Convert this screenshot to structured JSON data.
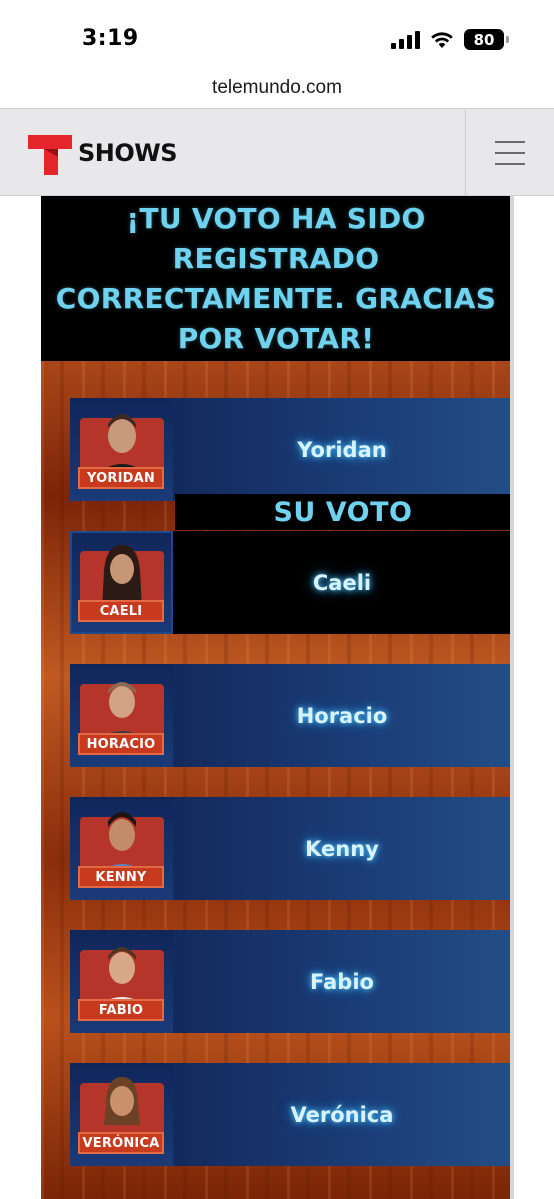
{
  "status_bar": {
    "time": "3:19",
    "battery": "80"
  },
  "browser": {
    "url": "telemundo.com"
  },
  "header": {
    "section_label": "SHOWS",
    "menu_icon": "hamburger-menu-icon",
    "logo_color": "#e4252c"
  },
  "vote": {
    "confirmation": "¡TU VOTO HA SIDO REGISTRADO CORRECTAMENTE. GRACIAS POR VOTAR!",
    "selected_label": "SU VOTO",
    "accent_color": "#6fd3f0",
    "candidates": [
      {
        "name": "Yoridan",
        "plate": "YORIDAN",
        "selected": false
      },
      {
        "name": "Caeli",
        "plate": "CAELI",
        "selected": true
      },
      {
        "name": "Horacio",
        "plate": "HORACIO",
        "selected": false
      },
      {
        "name": "Kenny",
        "plate": "KENNY",
        "selected": false
      },
      {
        "name": "Fabio",
        "plate": "FABIO",
        "selected": false
      },
      {
        "name": "Verónica",
        "plate": "VERÓNICA",
        "selected": false
      }
    ]
  }
}
